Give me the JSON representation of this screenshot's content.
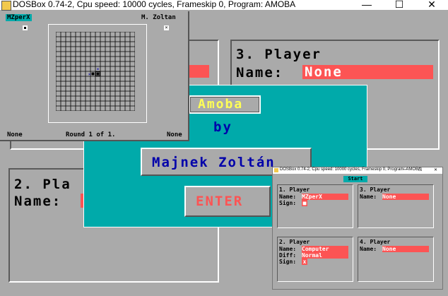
{
  "window": {
    "title": "DOSBox 0.74-2, Cpu speed:    10000 cycles, Frameskip  0, Program:   AMOBA",
    "minimize": "—",
    "maximize": "☐",
    "close": "✕"
  },
  "game_window": {
    "player1": "MZperX",
    "player2": "M. Zoltan",
    "left_status": "None",
    "round": "Round 1 of 1.",
    "right_status": "None"
  },
  "background": {
    "player3_title": "3. Player",
    "player3_name_label": "Name:",
    "player3_name_value": "None",
    "player2_title_partial": "2. Pla",
    "player2_name_label": "Name:"
  },
  "title_dialog": {
    "game_name": "Amoba",
    "by": "by",
    "author": "Majnek Zoltán",
    "enter": "ENTER"
  },
  "mini_window": {
    "title": "DOSBox 0.74-2, Cpu speed:    10000 cycles, Frameskip  0, Program:   AMOBA",
    "minimize": "—",
    "maximize": "☐",
    "close": "✕",
    "start_button": "Start",
    "panels": [
      {
        "title": "1. Player",
        "name_label": "Name:",
        "name_value": "MZperX",
        "sign_label": "Sign:",
        "sign_value": "■"
      },
      {
        "title": "3. Player",
        "name_label": "Name:",
        "name_value": "None"
      },
      {
        "title": "2. Player",
        "name_label": "Name:",
        "name_value": "Computer",
        "diff_label": "Diff:",
        "diff_value": "Normal",
        "sign_label": "Sign:",
        "sign_value": "x"
      },
      {
        "title": "4. Player",
        "name_label": "Name:",
        "name_value": "None"
      }
    ]
  }
}
